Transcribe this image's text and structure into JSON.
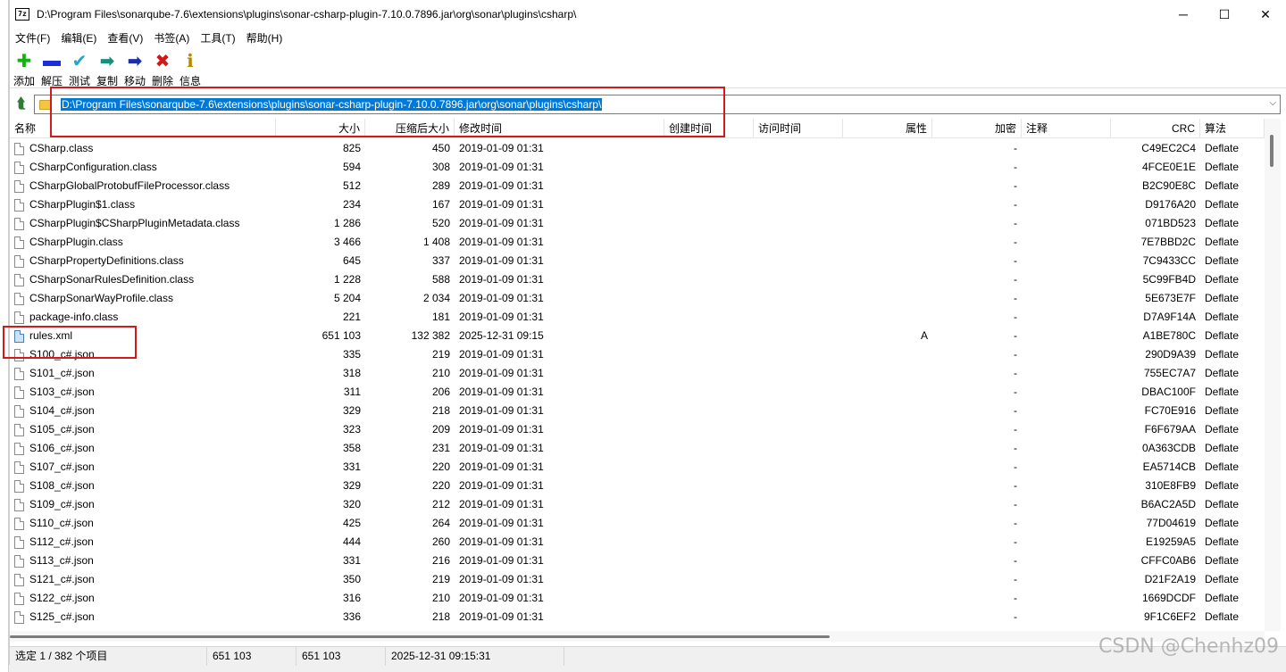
{
  "window": {
    "title": "D:\\Program Files\\sonarqube-7.6\\extensions\\plugins\\sonar-csharp-plugin-7.10.0.7896.jar\\org\\sonar\\plugins\\csharp\\",
    "app_icon_text": "7z",
    "minimize": "─",
    "maximize": "☐",
    "close": "✕"
  },
  "menu": [
    {
      "label": "文件(F)"
    },
    {
      "label": "编辑(E)"
    },
    {
      "label": "查看(V)"
    },
    {
      "label": "书签(A)"
    },
    {
      "label": "工具(T)"
    },
    {
      "label": "帮助(H)"
    }
  ],
  "toolbar": [
    {
      "label": "添加",
      "icon": "plus-icon",
      "glyph": "✚",
      "color": "#12b312"
    },
    {
      "label": "解压",
      "icon": "minus-icon",
      "glyph": "▬",
      "color": "#1a2fd6"
    },
    {
      "label": "测试",
      "icon": "check-icon",
      "glyph": "✔",
      "color": "#20a8c8"
    },
    {
      "label": "复制",
      "icon": "copy-arrow-icon",
      "glyph": "➡",
      "color": "#15907a"
    },
    {
      "label": "移动",
      "icon": "move-arrow-icon",
      "glyph": "➡",
      "color": "#1a2fa8"
    },
    {
      "label": "删除",
      "icon": "delete-x-icon",
      "glyph": "✖",
      "color": "#d01818"
    },
    {
      "label": "信息",
      "icon": "info-icon",
      "glyph": "ℹ",
      "color": "#b08a00"
    }
  ],
  "address": {
    "path": "D:\\Program Files\\sonarqube-7.6\\extensions\\plugins\\sonar-csharp-plugin-7.10.0.7896.jar\\org\\sonar\\plugins\\csharp\\",
    "dropdown": "⌵"
  },
  "columns": {
    "name": "名称",
    "size": "大小",
    "packed": "压缩后大小",
    "modified": "修改时间",
    "created": "创建时间",
    "accessed": "访问时间",
    "attributes": "属性",
    "encrypted": "加密",
    "comment": "注释",
    "crc": "CRC",
    "method": "算法"
  },
  "files": [
    {
      "name": "CSharp.class",
      "size": "825",
      "packed": "450",
      "modified": "2019-01-09 01:31",
      "attr": "",
      "enc": "-",
      "crc": "C49EC2C4",
      "method": "Deflate"
    },
    {
      "name": "CSharpConfiguration.class",
      "size": "594",
      "packed": "308",
      "modified": "2019-01-09 01:31",
      "attr": "",
      "enc": "-",
      "crc": "4FCE0E1E",
      "method": "Deflate"
    },
    {
      "name": "CSharpGlobalProtobufFileProcessor.class",
      "size": "512",
      "packed": "289",
      "modified": "2019-01-09 01:31",
      "attr": "",
      "enc": "-",
      "crc": "B2C90E8C",
      "method": "Deflate"
    },
    {
      "name": "CSharpPlugin$1.class",
      "size": "234",
      "packed": "167",
      "modified": "2019-01-09 01:31",
      "attr": "",
      "enc": "-",
      "crc": "D9176A20",
      "method": "Deflate"
    },
    {
      "name": "CSharpPlugin$CSharpPluginMetadata.class",
      "size": "1 286",
      "packed": "520",
      "modified": "2019-01-09 01:31",
      "attr": "",
      "enc": "-",
      "crc": "071BD523",
      "method": "Deflate"
    },
    {
      "name": "CSharpPlugin.class",
      "size": "3 466",
      "packed": "1 408",
      "modified": "2019-01-09 01:31",
      "attr": "",
      "enc": "-",
      "crc": "7E7BBD2C",
      "method": "Deflate"
    },
    {
      "name": "CSharpPropertyDefinitions.class",
      "size": "645",
      "packed": "337",
      "modified": "2019-01-09 01:31",
      "attr": "",
      "enc": "-",
      "crc": "7C9433CC",
      "method": "Deflate"
    },
    {
      "name": "CSharpSonarRulesDefinition.class",
      "size": "1 228",
      "packed": "588",
      "modified": "2019-01-09 01:31",
      "attr": "",
      "enc": "-",
      "crc": "5C99FB4D",
      "method": "Deflate"
    },
    {
      "name": "CSharpSonarWayProfile.class",
      "size": "5 204",
      "packed": "2 034",
      "modified": "2019-01-09 01:31",
      "attr": "",
      "enc": "-",
      "crc": "5E673E7F",
      "method": "Deflate"
    },
    {
      "name": "package-info.class",
      "size": "221",
      "packed": "181",
      "modified": "2019-01-09 01:31",
      "attr": "",
      "enc": "-",
      "crc": "D7A9F14A",
      "method": "Deflate"
    },
    {
      "name": "rules.xml",
      "size": "651 103",
      "packed": "132 382",
      "modified": "2025-12-31 09:15",
      "attr": "A",
      "enc": "-",
      "crc": "A1BE780C",
      "method": "Deflate",
      "type": "xml"
    },
    {
      "name": "S100_c#.json",
      "size": "335",
      "packed": "219",
      "modified": "2019-01-09 01:31",
      "attr": "",
      "enc": "-",
      "crc": "290D9A39",
      "method": "Deflate"
    },
    {
      "name": "S101_c#.json",
      "size": "318",
      "packed": "210",
      "modified": "2019-01-09 01:31",
      "attr": "",
      "enc": "-",
      "crc": "755EC7A7",
      "method": "Deflate"
    },
    {
      "name": "S103_c#.json",
      "size": "311",
      "packed": "206",
      "modified": "2019-01-09 01:31",
      "attr": "",
      "enc": "-",
      "crc": "DBAC100F",
      "method": "Deflate"
    },
    {
      "name": "S104_c#.json",
      "size": "329",
      "packed": "218",
      "modified": "2019-01-09 01:31",
      "attr": "",
      "enc": "-",
      "crc": "FC70E916",
      "method": "Deflate"
    },
    {
      "name": "S105_c#.json",
      "size": "323",
      "packed": "209",
      "modified": "2019-01-09 01:31",
      "attr": "",
      "enc": "-",
      "crc": "F6F679AA",
      "method": "Deflate"
    },
    {
      "name": "S106_c#.json",
      "size": "358",
      "packed": "231",
      "modified": "2019-01-09 01:31",
      "attr": "",
      "enc": "-",
      "crc": "0A363CDB",
      "method": "Deflate"
    },
    {
      "name": "S107_c#.json",
      "size": "331",
      "packed": "220",
      "modified": "2019-01-09 01:31",
      "attr": "",
      "enc": "-",
      "crc": "EA5714CB",
      "method": "Deflate"
    },
    {
      "name": "S108_c#.json",
      "size": "329",
      "packed": "220",
      "modified": "2019-01-09 01:31",
      "attr": "",
      "enc": "-",
      "crc": "310E8FB9",
      "method": "Deflate"
    },
    {
      "name": "S109_c#.json",
      "size": "320",
      "packed": "212",
      "modified": "2019-01-09 01:31",
      "attr": "",
      "enc": "-",
      "crc": "B6AC2A5D",
      "method": "Deflate"
    },
    {
      "name": "S110_c#.json",
      "size": "425",
      "packed": "264",
      "modified": "2019-01-09 01:31",
      "attr": "",
      "enc": "-",
      "crc": "77D04619",
      "method": "Deflate"
    },
    {
      "name": "S112_c#.json",
      "size": "444",
      "packed": "260",
      "modified": "2019-01-09 01:31",
      "attr": "",
      "enc": "-",
      "crc": "E19259A5",
      "method": "Deflate"
    },
    {
      "name": "S113_c#.json",
      "size": "331",
      "packed": "216",
      "modified": "2019-01-09 01:31",
      "attr": "",
      "enc": "-",
      "crc": "CFFC0AB6",
      "method": "Deflate"
    },
    {
      "name": "S121_c#.json",
      "size": "350",
      "packed": "219",
      "modified": "2019-01-09 01:31",
      "attr": "",
      "enc": "-",
      "crc": "D21F2A19",
      "method": "Deflate"
    },
    {
      "name": "S122_c#.json",
      "size": "316",
      "packed": "210",
      "modified": "2019-01-09 01:31",
      "attr": "",
      "enc": "-",
      "crc": "1669DCDF",
      "method": "Deflate"
    },
    {
      "name": "S125_c#.json",
      "size": "336",
      "packed": "218",
      "modified": "2019-01-09 01:31",
      "attr": "",
      "enc": "-",
      "crc": "9F1C6EF2",
      "method": "Deflate"
    }
  ],
  "status": {
    "selection": "选定 1 / 382 个项目",
    "size": "651 103",
    "packed": "651 103",
    "modified": "2025-12-31 09:15:31"
  },
  "watermark": "CSDN @Chenhz09",
  "colors": {
    "annotation": "#d21a1a",
    "selection": "#0078d7"
  }
}
